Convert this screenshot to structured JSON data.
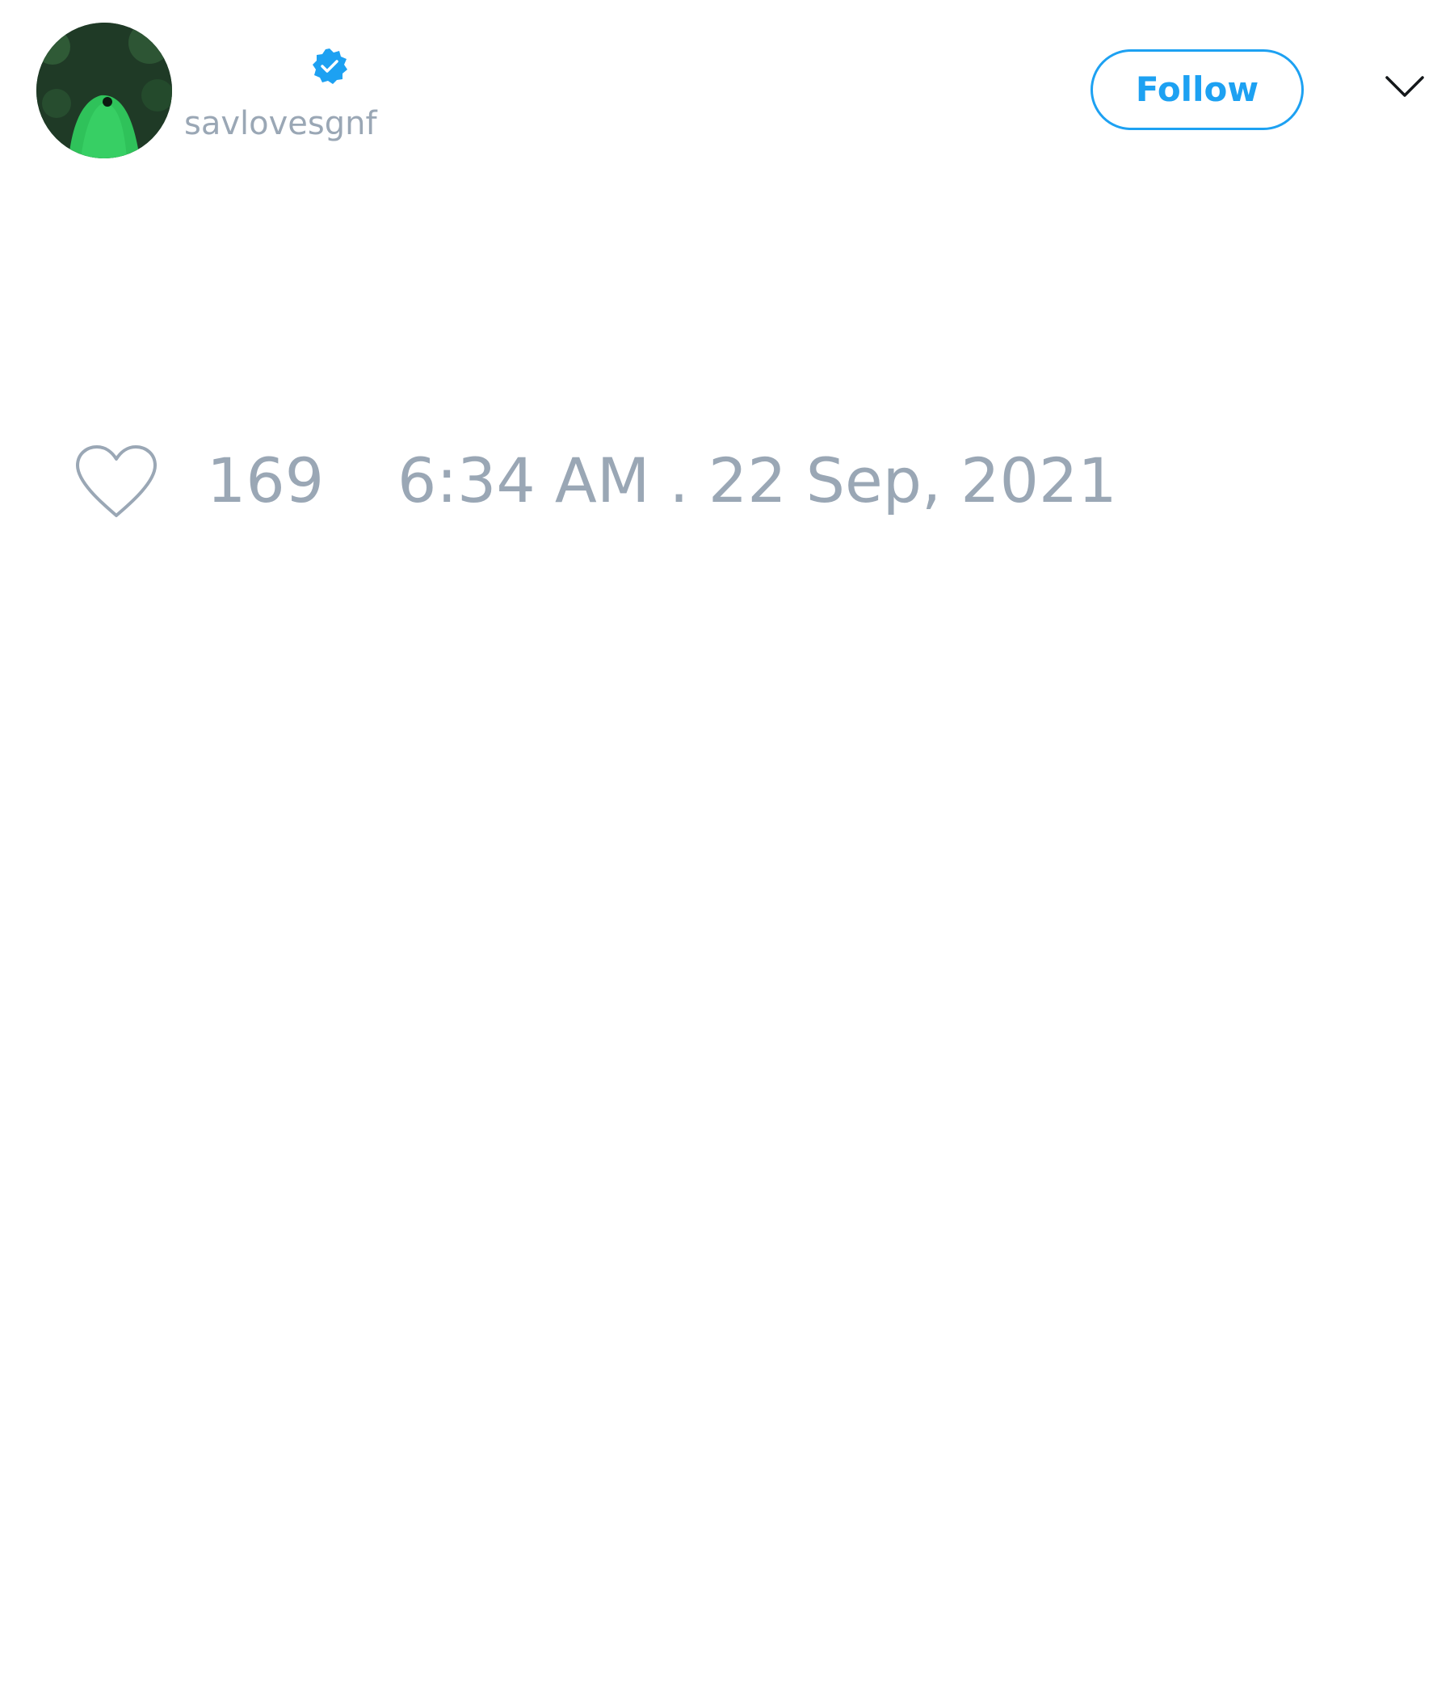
{
  "tweet": {
    "author": {
      "display_name": "",
      "handle": "savlovesgnf",
      "verified": true,
      "verified_icon": "verified-badge-icon",
      "avatar_icon": "green-ghost-avatar"
    },
    "follow_label": "Follow",
    "menu_icon": "chevron-down-icon",
    "like_icon": "heart-icon",
    "like_count": "169",
    "timestamp": "6:34 AM . 22 Sep, 2021"
  },
  "colors": {
    "accent": "#1da1f2",
    "muted_text": "#9aa7b5",
    "background": "#ffffff"
  }
}
